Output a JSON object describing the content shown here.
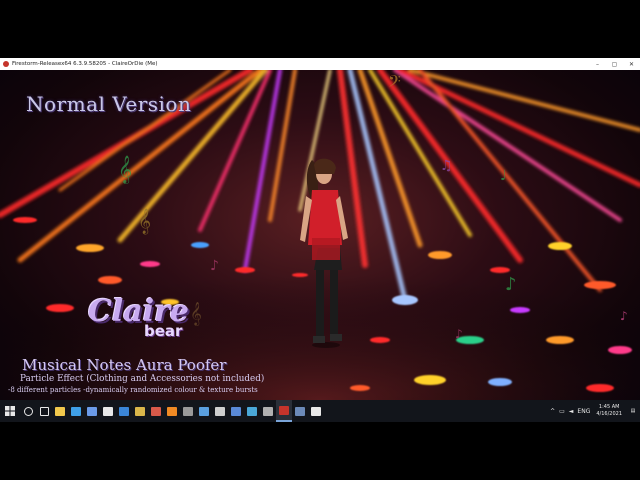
{
  "window": {
    "title": "Firestorm-Releasex64 6.3.9.58205 - ClaireOrDie (Me)",
    "controls": {
      "minimize": "–",
      "maximize": "▢",
      "close": "✕"
    }
  },
  "scene": {
    "overlay_heading": "Normal Version",
    "logo": {
      "word1": "Claire",
      "word2": "bear"
    },
    "product_title": "Musical Notes Aura Poofer",
    "subtitle": "Particle Effect (Clothing and Accessories not included)",
    "features": "-8 different particles  -dynamically randomized colour & texture bursts",
    "colors": {
      "ray_red": "#ff3030",
      "ray_orange": "#ff9a2a",
      "ray_blue": "#7fb0ff",
      "ray_magenta": "#ff4fd0",
      "text_lavender": "#d3c7f1"
    }
  },
  "taskbar": {
    "start_icon": "windows-icon",
    "apps": [
      {
        "icon": "search-icon",
        "color": "#e8e8e8"
      },
      {
        "icon": "task-view-icon",
        "color": "#e8e8e8"
      },
      {
        "icon": "file-explorer-icon",
        "color": "#f2c94c"
      },
      {
        "icon": "edge-icon",
        "color": "#3fa0e8"
      },
      {
        "icon": "store-icon",
        "color": "#6b9be8"
      },
      {
        "icon": "settings-icon",
        "color": "#e8e8e8"
      },
      {
        "icon": "globe-icon",
        "color": "#3b86d8"
      },
      {
        "icon": "folder-icon",
        "color": "#d9b64a"
      },
      {
        "icon": "app-icon",
        "color": "#d85a4a"
      },
      {
        "icon": "vlc-icon",
        "color": "#f08a24"
      },
      {
        "icon": "app-icon",
        "color": "#9a9a9a"
      },
      {
        "icon": "app-icon",
        "color": "#5aa0e0"
      },
      {
        "icon": "app-icon",
        "color": "#cfcfcf"
      },
      {
        "icon": "app-icon",
        "color": "#5a8ad8"
      },
      {
        "icon": "app-icon",
        "color": "#4aa8d8"
      },
      {
        "icon": "app-icon",
        "color": "#b0b0b0"
      },
      {
        "icon": "firestorm-icon",
        "color": "#c5342b"
      },
      {
        "icon": "steam-icon",
        "color": "#6c8ab8"
      },
      {
        "icon": "obs-icon",
        "color": "#e8e8e8"
      }
    ],
    "tray": {
      "chevron": "^",
      "lang": "ENG",
      "time": "1:45 AM",
      "date": "4/16/2021"
    }
  }
}
